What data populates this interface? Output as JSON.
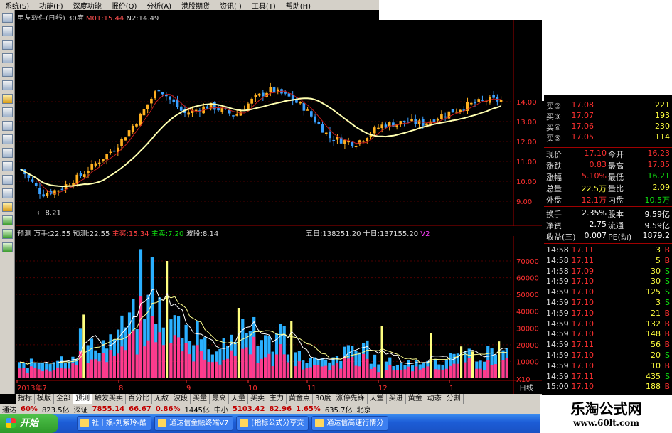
{
  "menu": [
    "系统(S)",
    "功能(F)",
    "深度功能",
    "报价(Q)",
    "分析(A)",
    "港股期货",
    "资讯(I)",
    "工具(T)",
    "帮助(H)"
  ],
  "chart_header": {
    "title": "用友软件(日线)",
    "period": "30度",
    "m1": "M01:15.44",
    "n2": "N2:14.49"
  },
  "price_axis": {
    "labels": [
      "14.00",
      "13.00",
      "12.00",
      "11.00",
      "10.00",
      "9.00"
    ]
  },
  "low_marker": "8.21",
  "volume_header": {
    "wan": "万手:22.55",
    "yuce": "预测:22.55",
    "zhumai": "主买:15.34",
    "zhumai2": "主卖:7.20",
    "other": "波段:8.14",
    "lbl": "预测",
    "n5": "五日:138251.20",
    "n10": "十日:137155.20",
    "v2": "V2"
  },
  "volume_axis": {
    "labels": [
      "70000",
      "60000",
      "50000",
      "40000",
      "30000",
      "20000",
      "10000"
    ],
    "unit": "X10"
  },
  "date_axis": {
    "labels": [
      "2013年7",
      "8",
      "9",
      "10",
      "11",
      "12",
      "1"
    ],
    "unit": "日线"
  },
  "order_book": [
    {
      "label": "买②",
      "price": "17.08",
      "vol": "221"
    },
    {
      "label": "买③",
      "price": "17.07",
      "vol": "193"
    },
    {
      "label": "买④",
      "price": "17.06",
      "vol": "230"
    },
    {
      "label": "买⑤",
      "price": "17.05",
      "vol": "114"
    }
  ],
  "quote": [
    {
      "l1": "现价",
      "v1": "17.10",
      "l2": "今开",
      "v2": "16.23"
    },
    {
      "l1": "涨跌",
      "v1": "0.83",
      "l2": "最高",
      "v2": "17.85"
    },
    {
      "l1": "涨幅",
      "v1": "5.10%",
      "l2": "最低",
      "v2": "16.21"
    },
    {
      "l1": "总量",
      "v1": "22.5万",
      "l2": "量比",
      "v2": "2.09"
    },
    {
      "l1": "外盘",
      "v1": "12.1万",
      "l2": "内盘",
      "v2": "10.5万"
    },
    {
      "l1": "换手",
      "v1": "2.35%",
      "l2": "股本",
      "v2": "9.59亿"
    },
    {
      "l1": "净资",
      "v1": "2.75",
      "l2": "流通",
      "v2": "9.59亿"
    },
    {
      "l1": "收益(三)",
      "v1": "0.007",
      "l2": "PE(动)",
      "v2": "1879.2"
    }
  ],
  "ticks": [
    {
      "t": "14:58",
      "p": "17.11",
      "v": "3",
      "d": "B"
    },
    {
      "t": "14:58",
      "p": "17.11",
      "v": "5",
      "d": "B"
    },
    {
      "t": "14:58",
      "p": "17.09",
      "v": "30",
      "d": "S"
    },
    {
      "t": "14:59",
      "p": "17.10",
      "v": "30",
      "d": "S"
    },
    {
      "t": "14:59",
      "p": "17.10",
      "v": "125",
      "d": "S"
    },
    {
      "t": "14:59",
      "p": "17.10",
      "v": "3",
      "d": "S"
    },
    {
      "t": "14:59",
      "p": "17.10",
      "v": "21",
      "d": "B"
    },
    {
      "t": "14:59",
      "p": "17.10",
      "v": "132",
      "d": "B"
    },
    {
      "t": "14:59",
      "p": "17.10",
      "v": "148",
      "d": "B"
    },
    {
      "t": "14:59",
      "p": "17.11",
      "v": "56",
      "d": "B"
    },
    {
      "t": "14:59",
      "p": "17.10",
      "v": "20",
      "d": "S"
    },
    {
      "t": "14:59",
      "p": "17.10",
      "v": "10",
      "d": "B"
    },
    {
      "t": "14:59",
      "p": "17.11",
      "v": "435",
      "d": "S"
    },
    {
      "t": "15:00",
      "p": "17.10",
      "v": "188",
      "d": "B"
    }
  ],
  "bottom_tabs": [
    "指标",
    "模版",
    "全部",
    "预测",
    "触发买卖",
    "百分比",
    "无敌",
    "波段",
    "买量",
    "最高",
    "天量",
    "买卖",
    "主力",
    "黄金点",
    "30度",
    "涨停先锋",
    "天堂",
    "买进",
    "黄金",
    "动态",
    "分割"
  ],
  "bottom_tab_active": 3,
  "status": {
    "a": "通达",
    "b": "60%",
    "c": "823.5亿",
    "d": "深证",
    "e": "7855.14",
    "f": "66.67",
    "g": "0.86%",
    "h": "1445亿",
    "i": "中小",
    "j": "5103.42",
    "k": "82.96",
    "l": "1.65%",
    "m": "635.7亿",
    "n": "北京"
  },
  "taskbar": {
    "start": "开始",
    "tasks": [
      "社十娘-刘紫玲-酷",
      "通达信金融终端V7",
      "[指标公式分享交",
      "通达信高速行情分"
    ]
  },
  "brand": {
    "line1": "乐淘公式网",
    "line2": "www.60lt.com"
  },
  "colors": {
    "up": "#ff3030",
    "down": "#10e010",
    "candle_up": "#ffb020",
    "candle_down": "#3aa0ff",
    "ma1": "#ffffb0",
    "ma2": "#c81c1c",
    "vol_pink": "#ff3a8c",
    "vol_blue": "#2ab0ff",
    "vol_yellow": "#ffff80"
  }
}
